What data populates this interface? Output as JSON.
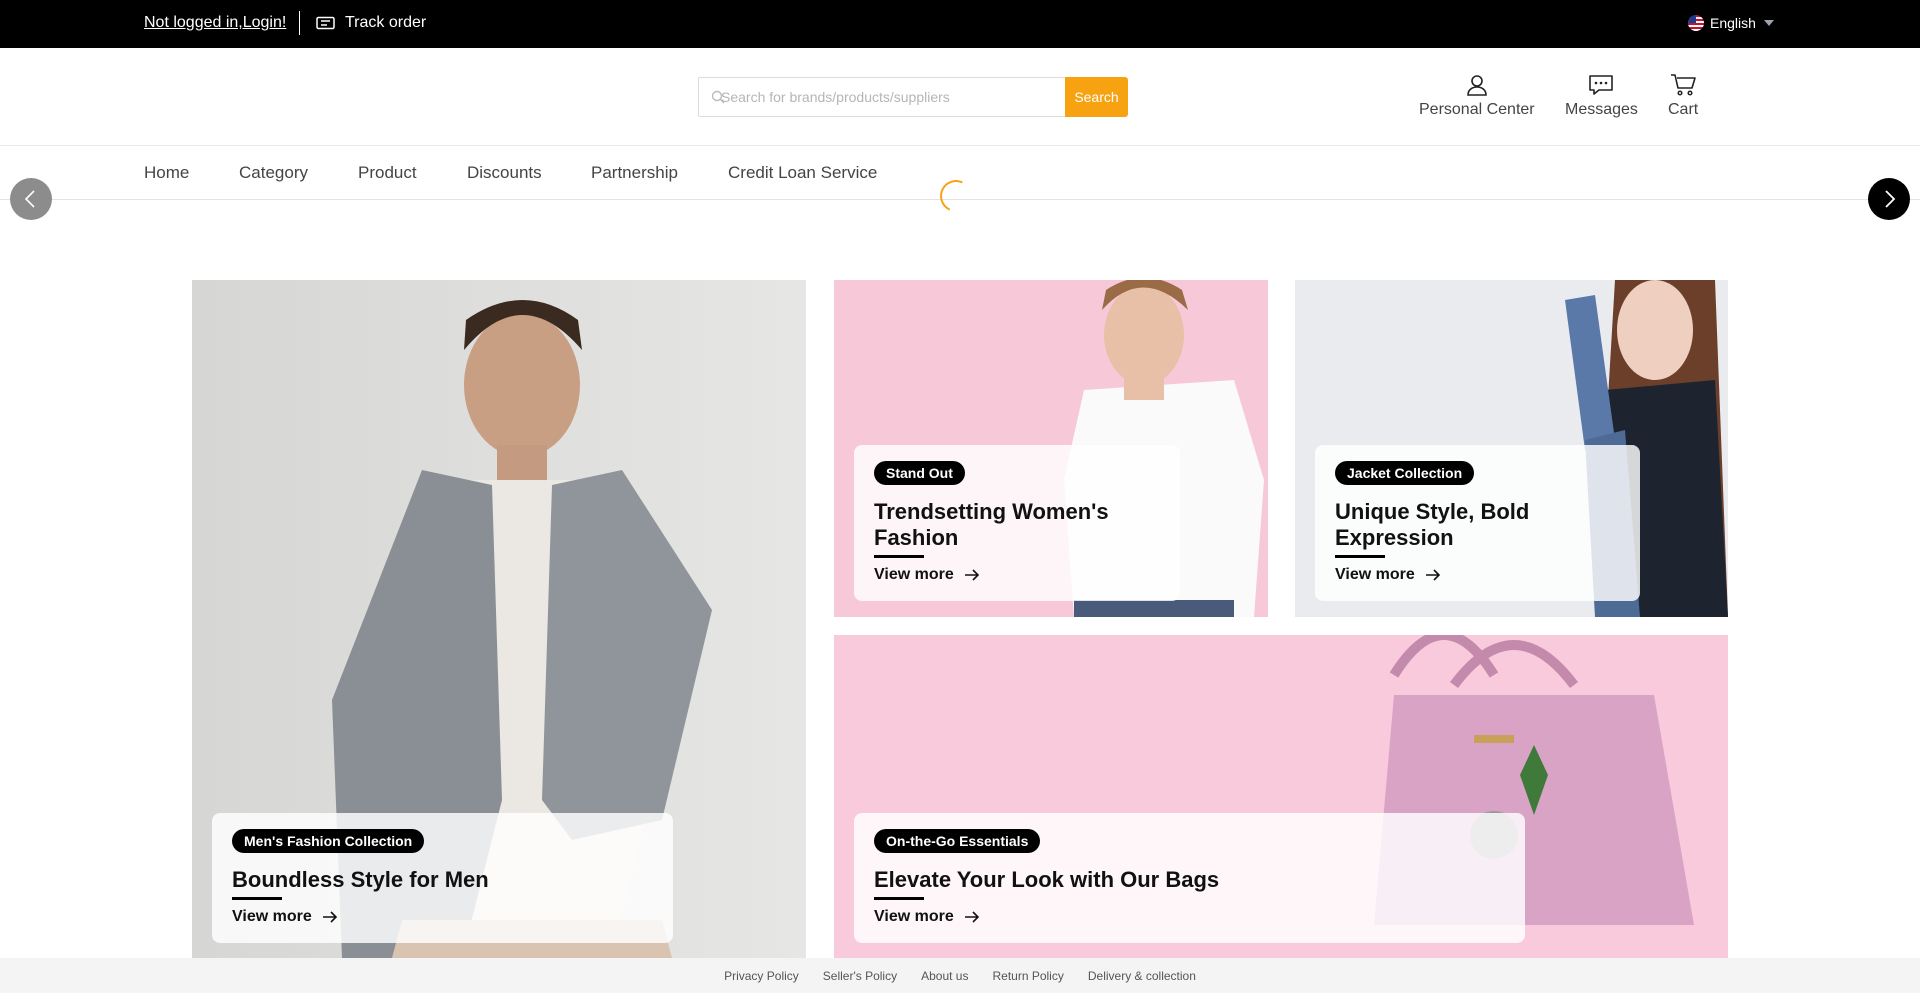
{
  "topbar": {
    "login_text": "Not logged in,Login!",
    "track_order": "Track order",
    "track_icon": "ticket-icon",
    "language": "English",
    "flag_icon": "us-flag-icon"
  },
  "search": {
    "placeholder": "Search for brands/products/suppliers",
    "button_label": "Search",
    "accent_color": "#f7a211"
  },
  "header_actions": [
    {
      "label": "Personal Center",
      "icon": "user-icon"
    },
    {
      "label": "Messages",
      "icon": "chat-icon"
    },
    {
      "label": "Cart",
      "icon": "cart-icon"
    }
  ],
  "nav": {
    "items": [
      "Home",
      "Category",
      "Product",
      "Discounts",
      "Partnership",
      "Credit Loan Service"
    ]
  },
  "banners": {
    "men": {
      "tag": "Men's Fashion Collection",
      "title": "Boundless Style for Men",
      "cta": "View more"
    },
    "women": {
      "tag": "Stand Out",
      "title": "Trendsetting Women's Fashion",
      "cta": "View more"
    },
    "jacket": {
      "tag": "Jacket Collection",
      "title": "Unique Style, Bold Expression",
      "cta": "View more"
    },
    "bags": {
      "tag": "On-the-Go Essentials",
      "title": "Elevate Your Look with Our Bags",
      "cta": "View more"
    }
  },
  "footer": {
    "links": [
      "Privacy Policy",
      "Seller's Policy",
      "About us",
      "Return Policy",
      "Delivery & collection"
    ]
  }
}
